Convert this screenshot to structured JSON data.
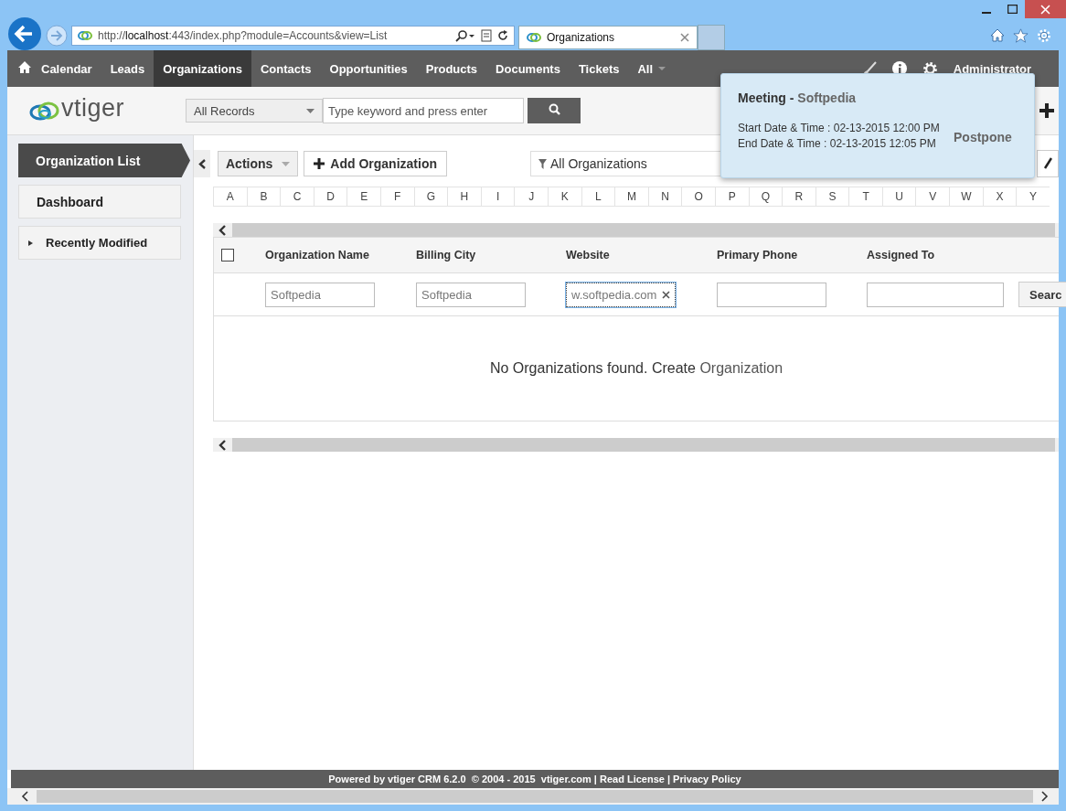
{
  "browser": {
    "url": "http://**localhost**:443/index.php?module=Accounts&view=List",
    "tab": "Organizations"
  },
  "nav": {
    "items": [
      {
        "label": "Calendar",
        "selected": false
      },
      {
        "label": "Leads",
        "selected": false
      },
      {
        "label": "Organizations",
        "selected": true
      },
      {
        "label": "Contacts",
        "selected": false
      },
      {
        "label": "Opportunities",
        "selected": false
      },
      {
        "label": "Products",
        "selected": false
      },
      {
        "label": "Documents",
        "selected": false
      },
      {
        "label": "Tickets",
        "selected": false
      },
      {
        "label": "All",
        "selected": false
      }
    ],
    "user": "Administrator"
  },
  "header": {
    "logo": "vtiger",
    "record_type": "All Records",
    "search": {
      "placeholder": "Type keyword and press enter"
    }
  },
  "sidebar": {
    "items": [
      {
        "label": "Organization List",
        "selected": true,
        "kind": "link"
      },
      {
        "label": "Dashboard",
        "selected": false,
        "kind": "link"
      },
      {
        "label": "Recently Modified",
        "selected": false,
        "kind": "expandable"
      }
    ]
  },
  "toolbar": {
    "actions": "Actions",
    "add": "Add Organization",
    "filter": "All Organizations"
  },
  "alphabet": [
    "A",
    "B",
    "C",
    "D",
    "E",
    "F",
    "G",
    "H",
    "I",
    "J",
    "K",
    "L",
    "M",
    "N",
    "O",
    "P",
    "Q",
    "R",
    "S",
    "T",
    "U",
    "V",
    "W",
    "X",
    "Y"
  ],
  "table": {
    "select_all": {
      "checked": false
    },
    "columns": [
      "Organization Name",
      "Billing City",
      "Website",
      "Primary Phone",
      "Assigned To"
    ],
    "filters": [
      {
        "value": "Softpedia",
        "focused": false
      },
      {
        "value": "Softpedia",
        "focused": false
      },
      {
        "value": "w.softpedia.com",
        "focused": true
      },
      {
        "focused": false
      },
      {
        "focused": false
      }
    ],
    "search_button": "Searc",
    "empty_message": "No Organizations found. Create",
    "empty_link": "Organization"
  },
  "popup": {
    "title": "Meeting",
    "separator": "-",
    "subject": "Softpedia",
    "start": "Start Date & Time : 02-13-2015 12:00 PM",
    "end": "End Date & Time : 02-13-2015 12:05 PM",
    "action": "Postpone"
  },
  "footer": "Powered by vtiger CRM 6.2.0  © 2004 - 2015  vtiger.com | Read License | Privacy Policy"
}
